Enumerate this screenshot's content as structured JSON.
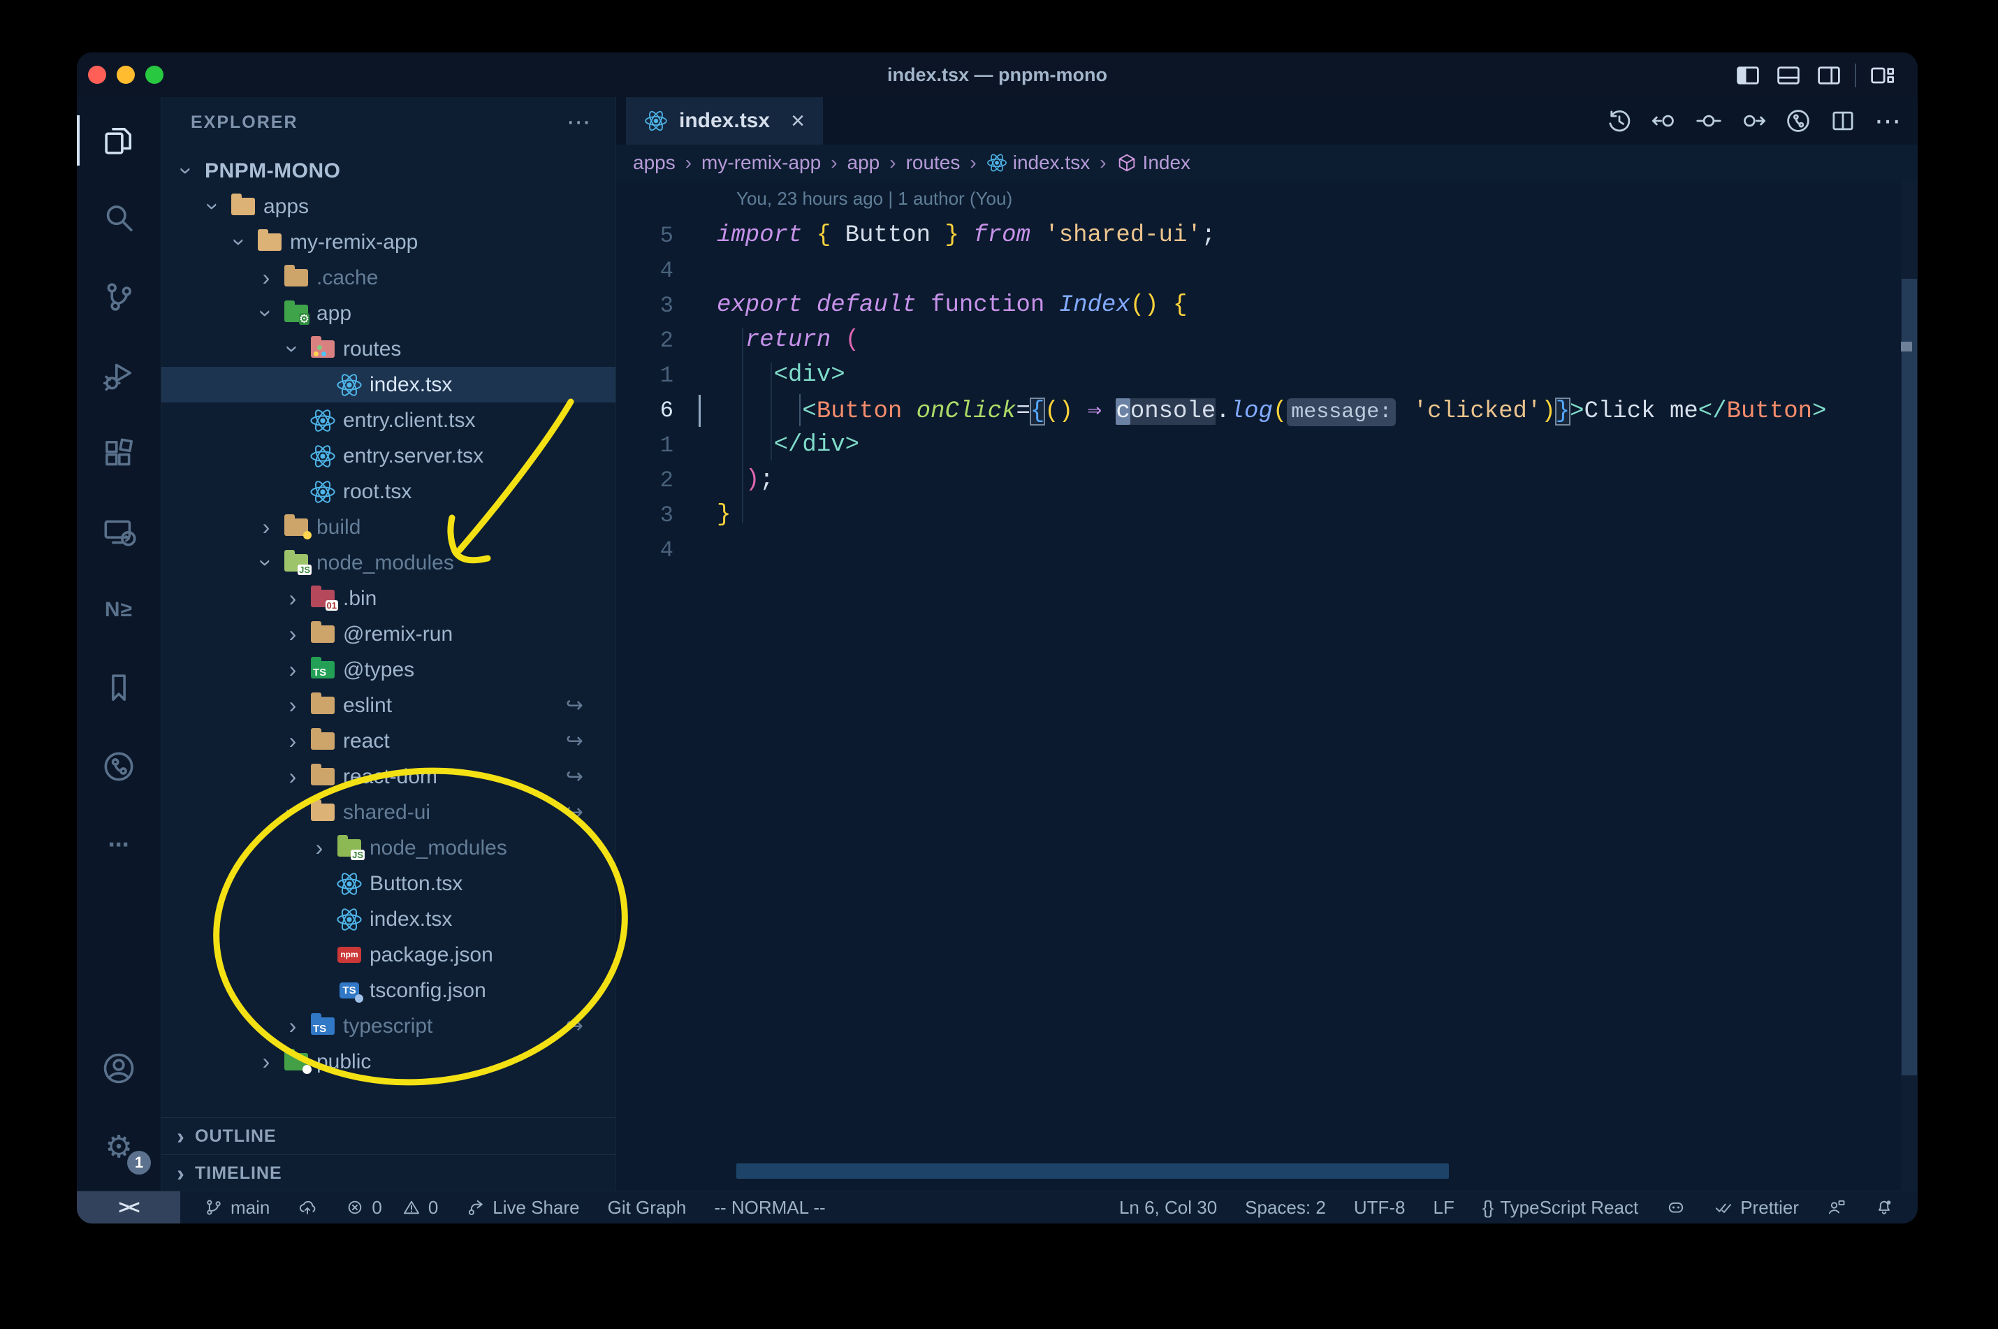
{
  "window": {
    "title": "index.tsx — pnpm-mono",
    "traffic_lights": [
      "close",
      "minimize",
      "zoom"
    ],
    "controls": [
      {
        "name": "toggle-primary-sidebar"
      },
      {
        "name": "toggle-panel"
      },
      {
        "name": "toggle-secondary-sidebar"
      },
      {
        "name": "customize-layout"
      }
    ]
  },
  "glyphs": {
    "chevron": "›",
    "crumb_sep": "›",
    "symlink": "↪",
    "braces": "{}",
    "gear": "⚙",
    "more": "⋯",
    "close": "×",
    "remote": "><"
  },
  "activity_bar": {
    "top": [
      {
        "name": "explorer",
        "active": true
      },
      {
        "name": "search"
      },
      {
        "name": "source-control"
      },
      {
        "name": "run-debug"
      },
      {
        "name": "extensions"
      },
      {
        "name": "remote-explorer"
      },
      {
        "name": "nx-console",
        "text": "N≥"
      },
      {
        "name": "bookmarks"
      },
      {
        "name": "gitlens"
      },
      {
        "name": "more",
        "text": "⋯"
      }
    ],
    "bottom": [
      {
        "name": "accounts"
      },
      {
        "name": "settings",
        "glyph": "⚙",
        "badge": "1"
      }
    ]
  },
  "explorer": {
    "header": "EXPLORER",
    "header_more": "⋯",
    "rows": [
      {
        "d": 0,
        "label": "PNPM-MONO",
        "chev": "down",
        "workspace": true
      },
      {
        "d": 1,
        "label": "apps",
        "chev": "down",
        "icon": "folder-open"
      },
      {
        "d": 2,
        "label": "my-remix-app",
        "chev": "down",
        "icon": "folder-open"
      },
      {
        "d": 3,
        "label": ".cache",
        "chev": "right",
        "icon": "folder",
        "dim": true
      },
      {
        "d": 3,
        "label": "app",
        "chev": "down",
        "icon": "folder-app"
      },
      {
        "d": 4,
        "label": "routes",
        "chev": "down",
        "icon": "folder-routes"
      },
      {
        "d": 5,
        "label": "index.tsx",
        "icon": "react",
        "selected": true
      },
      {
        "d": 4,
        "label": "entry.client.tsx",
        "icon": "react"
      },
      {
        "d": 4,
        "label": "entry.server.tsx",
        "icon": "react"
      },
      {
        "d": 4,
        "label": "root.tsx",
        "icon": "react"
      },
      {
        "d": 3,
        "label": "build",
        "chev": "right",
        "icon": "folder-build",
        "dim": true
      },
      {
        "d": 3,
        "label": "node_modules",
        "chev": "down",
        "icon": "folder-node-open",
        "dim": true
      },
      {
        "d": 4,
        "label": ".bin",
        "chev": "right",
        "icon": "folder-binary"
      },
      {
        "d": 4,
        "label": "@remix-run",
        "chev": "right",
        "icon": "folder"
      },
      {
        "d": 4,
        "label": "@types",
        "chev": "right",
        "icon": "folder-types"
      },
      {
        "d": 4,
        "label": "eslint",
        "chev": "right",
        "icon": "folder",
        "symlink": true
      },
      {
        "d": 4,
        "label": "react",
        "chev": "right",
        "icon": "folder",
        "symlink": true
      },
      {
        "d": 4,
        "label": "react-dom",
        "chev": "right",
        "icon": "folder",
        "symlink": true
      },
      {
        "d": 4,
        "label": "shared-ui",
        "chev": "down",
        "icon": "folder-open",
        "symlink": true,
        "dim": true
      },
      {
        "d": 5,
        "label": "node_modules",
        "chev": "right",
        "icon": "folder-node",
        "dim": true
      },
      {
        "d": 5,
        "label": "Button.tsx",
        "icon": "react"
      },
      {
        "d": 5,
        "label": "index.tsx",
        "icon": "react"
      },
      {
        "d": 5,
        "label": "package.json",
        "icon": "npm"
      },
      {
        "d": 5,
        "label": "tsconfig.json",
        "icon": "tsconfig"
      },
      {
        "d": 4,
        "label": "typescript",
        "chev": "right",
        "icon": "folder-ts",
        "symlink": true,
        "dim": true
      },
      {
        "d": 3,
        "label": "public",
        "chev": "right",
        "icon": "folder-public"
      }
    ],
    "sections": [
      {
        "label": "OUTLINE"
      },
      {
        "label": "TIMELINE"
      }
    ]
  },
  "editor": {
    "tab": {
      "label": "index.tsx",
      "close": "×",
      "icon": "react"
    },
    "actions": [
      {
        "name": "history"
      },
      {
        "name": "previous-change"
      },
      {
        "name": "open-changes"
      },
      {
        "name": "next-change"
      },
      {
        "name": "gitlens-graph"
      },
      {
        "name": "split-editor"
      },
      {
        "name": "more-actions",
        "text": "⋯"
      }
    ],
    "breadcrumbs": [
      {
        "label": "apps"
      },
      {
        "label": "my-remix-app"
      },
      {
        "label": "app"
      },
      {
        "label": "routes"
      },
      {
        "label": "index.tsx",
        "icon": "react"
      },
      {
        "label": "Index",
        "icon": "symbol-module"
      }
    ],
    "codelens": "You, 23 hours ago | 1 author (You)",
    "cursor": {
      "line": 6,
      "col": 30
    },
    "lines": [
      {
        "n": "5",
        "tokens": [
          [
            "import",
            "kw"
          ],
          [
            " ",
            ""
          ],
          [
            "{",
            "gold"
          ],
          [
            " Button ",
            "var"
          ],
          [
            "}",
            "gold"
          ],
          [
            " ",
            ""
          ],
          [
            "from",
            "kw"
          ],
          [
            " ",
            ""
          ],
          [
            "'shared-ui'",
            "str"
          ],
          [
            ";",
            "punct"
          ]
        ]
      },
      {
        "n": "4",
        "tokens": []
      },
      {
        "n": "3",
        "tokens": [
          [
            "export",
            "kw"
          ],
          [
            " ",
            ""
          ],
          [
            "default",
            "kw"
          ],
          [
            " ",
            ""
          ],
          [
            "function",
            "kwu"
          ],
          [
            " ",
            ""
          ],
          [
            "Index",
            "fn"
          ],
          [
            "()",
            "gold"
          ],
          [
            " ",
            ""
          ],
          [
            "{",
            "gold"
          ]
        ]
      },
      {
        "n": "2",
        "tokens": [
          [
            "  ",
            ""
          ],
          [
            "return",
            "kw"
          ],
          [
            " ",
            ""
          ],
          [
            "(",
            "paren"
          ]
        ]
      },
      {
        "n": "1",
        "tokens": [
          [
            "    ",
            ""
          ],
          [
            "<div>",
            "tag"
          ]
        ]
      },
      {
        "n": "6",
        "active": true,
        "tokens": [
          [
            "      ",
            ""
          ],
          [
            "<",
            "tag"
          ],
          [
            "Button",
            "comp"
          ],
          [
            " ",
            ""
          ],
          [
            "onClick",
            "attr"
          ],
          [
            "=",
            "punct"
          ],
          [
            "{",
            "bracket"
          ],
          [
            "()",
            "gold"
          ],
          [
            " ",
            ""
          ],
          [
            "⇒",
            "arrow"
          ],
          [
            " ",
            ""
          ],
          [
            "c",
            "cursor wordhl"
          ],
          [
            "onsole",
            "wordhl"
          ],
          [
            ".",
            "punct"
          ],
          [
            "log",
            "fn"
          ],
          [
            "(",
            "gold"
          ],
          [
            "message:",
            "inlay"
          ],
          [
            " ",
            ""
          ],
          [
            "'clicked'",
            "str"
          ],
          [
            ")",
            "gold"
          ],
          [
            "}",
            "bracket"
          ],
          [
            ">",
            "tag"
          ],
          [
            "Click me",
            "var"
          ],
          [
            "</",
            "tag"
          ],
          [
            "Button",
            "comp"
          ],
          [
            ">",
            "tag"
          ]
        ]
      },
      {
        "n": "1",
        "tokens": [
          [
            "    ",
            ""
          ],
          [
            "</div>",
            "tag"
          ]
        ]
      },
      {
        "n": "2",
        "tokens": [
          [
            "  ",
            ""
          ],
          [
            ")",
            "paren"
          ],
          [
            ";",
            "punct"
          ]
        ]
      },
      {
        "n": "3",
        "tokens": [
          [
            "}",
            "gold"
          ]
        ]
      },
      {
        "n": "4",
        "tokens": []
      }
    ]
  },
  "status_bar": {
    "remote": "><",
    "left": [
      {
        "name": "git-branch",
        "icon": "git-branch",
        "label": "main"
      },
      {
        "name": "publish",
        "icon": "cloud-upload"
      },
      {
        "name": "problems",
        "parts": [
          {
            "icon": "error",
            "label": "0"
          },
          {
            "icon": "warning",
            "label": "0"
          }
        ]
      },
      {
        "name": "live-share",
        "icon": "live-share",
        "label": "Live Share"
      },
      {
        "name": "git-graph",
        "label": "Git Graph"
      },
      {
        "name": "vim-mode",
        "label": "-- NORMAL --"
      }
    ],
    "right": [
      {
        "name": "cursor-position",
        "label": "Ln 6, Col 30"
      },
      {
        "name": "indentation",
        "label": "Spaces: 2"
      },
      {
        "name": "encoding",
        "label": "UTF-8"
      },
      {
        "name": "eol",
        "label": "LF"
      },
      {
        "name": "language-mode",
        "text_icon": "{}",
        "label": "TypeScript React"
      },
      {
        "name": "copilot",
        "icon": "copilot"
      },
      {
        "name": "prettier",
        "icon": "double-check",
        "label": "Prettier"
      },
      {
        "name": "feedback",
        "icon": "feedback"
      },
      {
        "name": "notifications",
        "icon": "bell-dot"
      }
    ]
  },
  "annotation_color": "#f3e114",
  "colors": {
    "editor_bg": "#0b1a2e",
    "sidebar_bg": "#0d1e33",
    "titlebar_bg": "#0b1526",
    "statusbar_bg": "#0d1c30",
    "selection_row": "#1d3450",
    "accent_react": "#4fb5e8"
  }
}
